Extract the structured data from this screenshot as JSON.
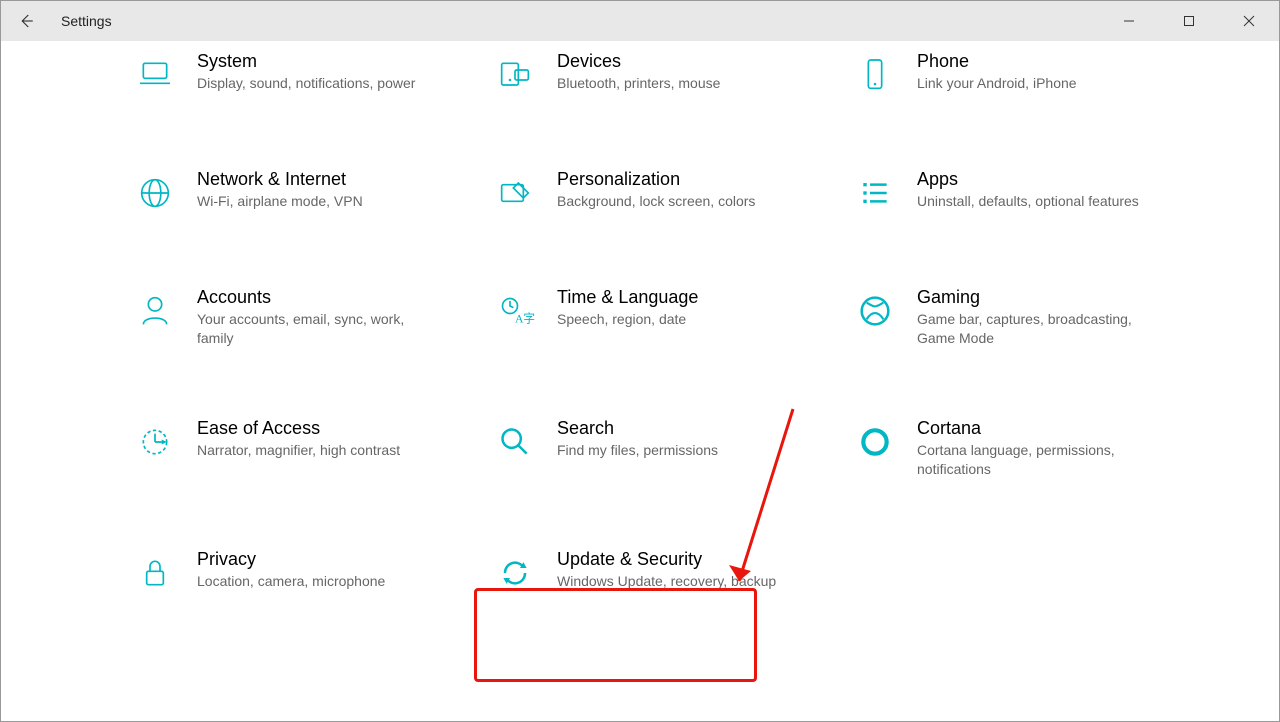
{
  "window": {
    "title": "Settings"
  },
  "accent": "#00b7c3",
  "tiles": [
    {
      "id": "system",
      "title": "System",
      "desc": "Display, sound, notifications, power"
    },
    {
      "id": "devices",
      "title": "Devices",
      "desc": "Bluetooth, printers, mouse"
    },
    {
      "id": "phone",
      "title": "Phone",
      "desc": "Link your Android, iPhone"
    },
    {
      "id": "network",
      "title": "Network & Internet",
      "desc": "Wi-Fi, airplane mode, VPN"
    },
    {
      "id": "personalization",
      "title": "Personalization",
      "desc": "Background, lock screen, colors"
    },
    {
      "id": "apps",
      "title": "Apps",
      "desc": "Uninstall, defaults, optional features"
    },
    {
      "id": "accounts",
      "title": "Accounts",
      "desc": "Your accounts, email, sync, work, family"
    },
    {
      "id": "time",
      "title": "Time & Language",
      "desc": "Speech, region, date"
    },
    {
      "id": "gaming",
      "title": "Gaming",
      "desc": "Game bar, captures, broadcasting, Game Mode"
    },
    {
      "id": "ease",
      "title": "Ease of Access",
      "desc": "Narrator, magnifier, high contrast"
    },
    {
      "id": "search",
      "title": "Search",
      "desc": "Find my files, permissions"
    },
    {
      "id": "cortana",
      "title": "Cortana",
      "desc": "Cortana language, permissions, notifications"
    },
    {
      "id": "privacy",
      "title": "Privacy",
      "desc": "Location, camera, microphone"
    },
    {
      "id": "update",
      "title": "Update & Security",
      "desc": "Windows Update, recovery, backup"
    }
  ],
  "annotation": {
    "highlight_tile_id": "update"
  }
}
